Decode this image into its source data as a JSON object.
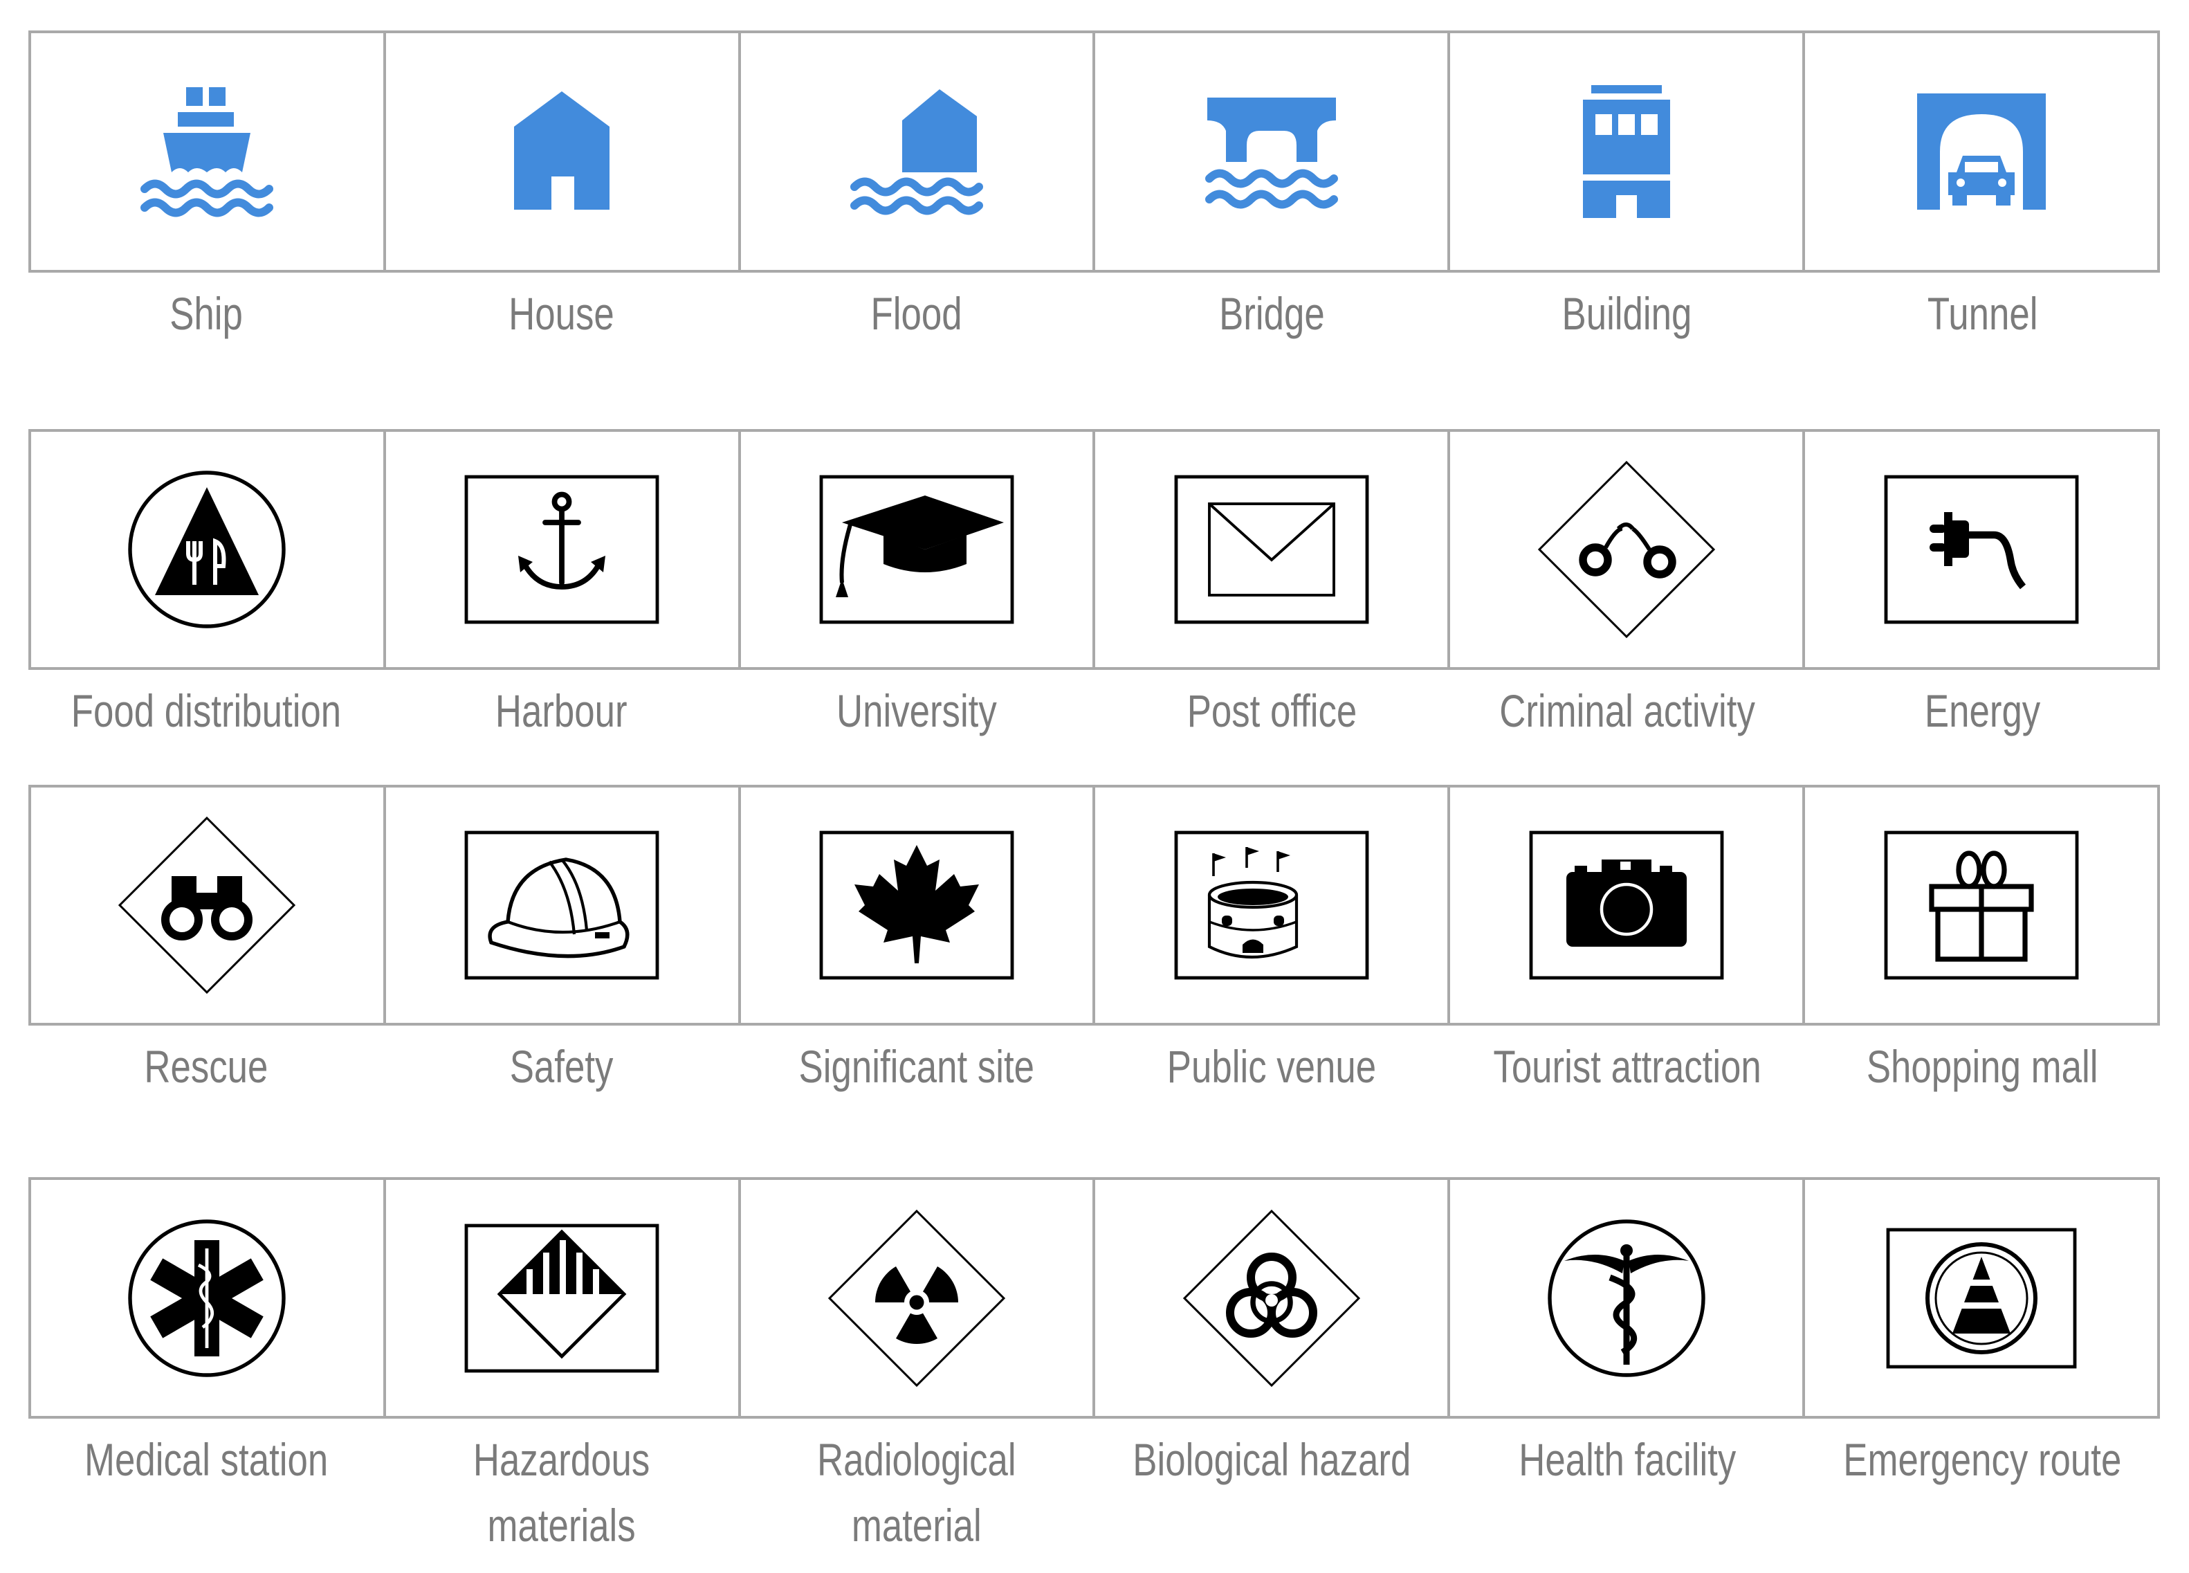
{
  "colors": {
    "blue_icon": "#428bdc",
    "black_icon": "#000000",
    "grid_border": "#a9a9a9",
    "label_text": "#7b7b7b"
  },
  "rows": [
    {
      "items": [
        {
          "label": "Ship",
          "icon": "ship-icon"
        },
        {
          "label": "House",
          "icon": "house-icon"
        },
        {
          "label": "Flood",
          "icon": "flood-icon"
        },
        {
          "label": "Bridge",
          "icon": "bridge-icon"
        },
        {
          "label": "Building",
          "icon": "building-icon"
        },
        {
          "label": "Tunnel",
          "icon": "tunnel-icon"
        }
      ]
    },
    {
      "items": [
        {
          "label": "Food distribution",
          "icon": "food-distribution-icon"
        },
        {
          "label": "Harbour",
          "icon": "anchor-icon"
        },
        {
          "label": "University",
          "icon": "graduation-cap-icon"
        },
        {
          "label": "Post office",
          "icon": "envelope-icon"
        },
        {
          "label": "Criminal activity",
          "icon": "handcuffs-icon"
        },
        {
          "label": "Energy",
          "icon": "plug-icon"
        }
      ]
    },
    {
      "items": [
        {
          "label": "Rescue",
          "icon": "binoculars-icon"
        },
        {
          "label": "Safety",
          "icon": "hard-hat-icon"
        },
        {
          "label": "Significant site",
          "icon": "maple-leaf-icon"
        },
        {
          "label": "Public venue",
          "icon": "stadium-icon"
        },
        {
          "label": "Tourist attraction",
          "icon": "camera-icon"
        },
        {
          "label": "Shopping mall",
          "icon": "gift-icon"
        }
      ]
    },
    {
      "items": [
        {
          "label": "Medical station",
          "icon": "star-of-life-icon"
        },
        {
          "label": "Hazardous\nmaterials",
          "icon": "hazardous-materials-icon"
        },
        {
          "label": "Radiological\nmaterial",
          "icon": "radiation-icon"
        },
        {
          "label": "Biological hazard",
          "icon": "biohazard-icon"
        },
        {
          "label": "Health facility",
          "icon": "caduceus-icon"
        },
        {
          "label": "Emergency route",
          "icon": "traffic-cone-icon"
        }
      ]
    }
  ]
}
